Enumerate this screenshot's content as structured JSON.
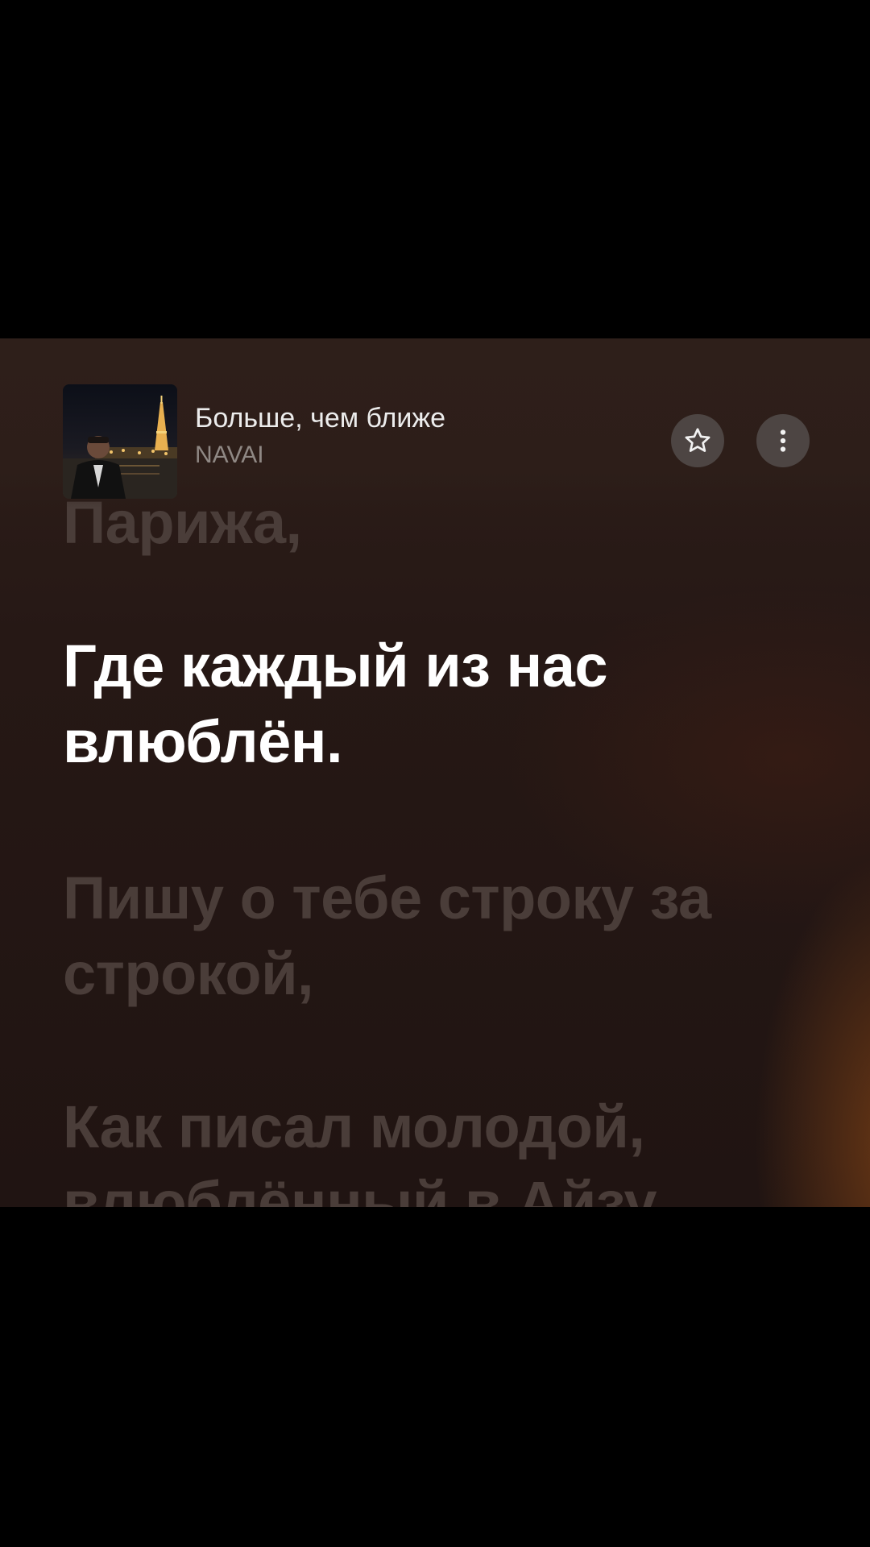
{
  "track": {
    "title": "Больше, чем ближе",
    "artist": "NAVAI"
  },
  "buttons": {
    "favorite_icon": "star-outline-icon",
    "more_icon": "vertical-ellipsis-icon"
  },
  "lyrics": {
    "previous_line": "Парижа,",
    "current_line_1": "Где каждый из нас",
    "current_line_2": "влюблён.",
    "next_1_line_1": "Пишу о тебе строку за",
    "next_1_line_2": "строкой,",
    "next_2_line_1": "Как писал молодой,",
    "next_2_line_2": "влюблённый в Айзу"
  },
  "colors": {
    "background": "#261815",
    "active_lyric": "#ffffff",
    "dim_lyric": "#4a3d39",
    "button_bg": "#4d4543"
  }
}
